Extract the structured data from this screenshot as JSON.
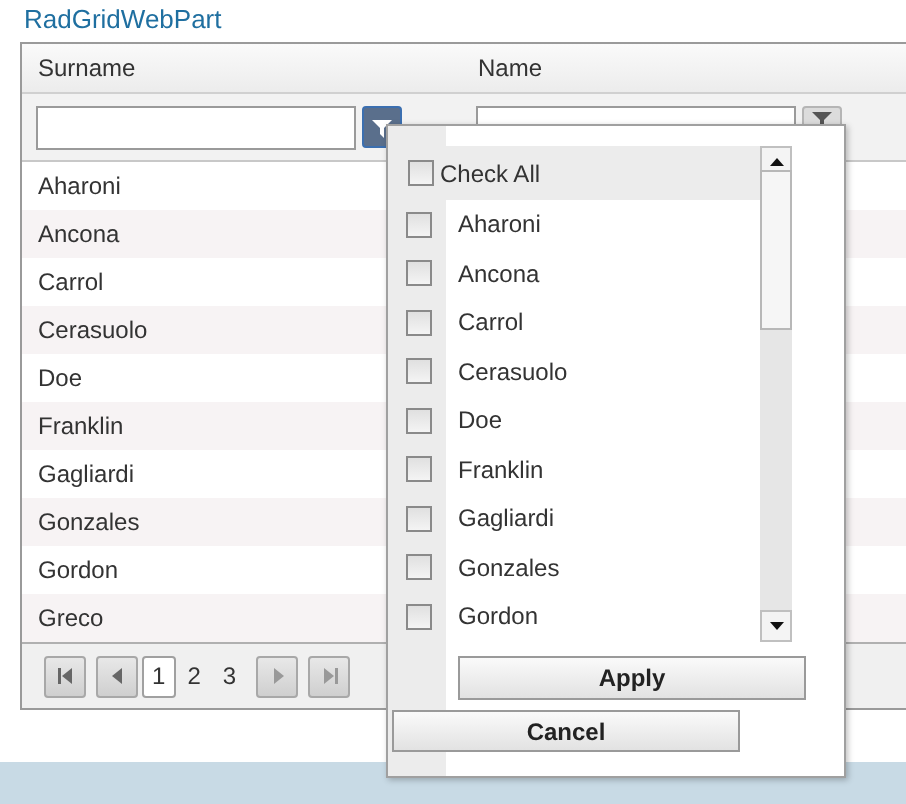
{
  "title": "RadGridWebPart",
  "columns": [
    {
      "label": "Surname",
      "filter_active": true
    },
    {
      "label": "Name",
      "filter_active": false
    }
  ],
  "rows": [
    {
      "surname": "Aharoni"
    },
    {
      "surname": "Ancona"
    },
    {
      "surname": "Carrol"
    },
    {
      "surname": "Cerasuolo"
    },
    {
      "surname": "Doe"
    },
    {
      "surname": "Franklin"
    },
    {
      "surname": "Gagliardi"
    },
    {
      "surname": "Gonzales"
    },
    {
      "surname": "Gordon"
    },
    {
      "surname": "Greco"
    }
  ],
  "pager": {
    "pages": [
      {
        "label": "1",
        "selected": true
      },
      {
        "label": "2",
        "selected": false
      },
      {
        "label": "3",
        "selected": false
      }
    ]
  },
  "filter_menu": {
    "check_all": {
      "label": "Check All",
      "checked": false
    },
    "items": [
      {
        "label": "Aharoni",
        "checked": false
      },
      {
        "label": "Ancona",
        "checked": false
      },
      {
        "label": "Carrol",
        "checked": false
      },
      {
        "label": "Cerasuolo",
        "checked": false
      },
      {
        "label": "Doe",
        "checked": false
      },
      {
        "label": "Franklin",
        "checked": false
      },
      {
        "label": "Gagliardi",
        "checked": false
      },
      {
        "label": "Gonzales",
        "checked": false
      },
      {
        "label": "Gordon",
        "checked": false
      }
    ],
    "apply": "Apply",
    "cancel": "Cancel"
  }
}
